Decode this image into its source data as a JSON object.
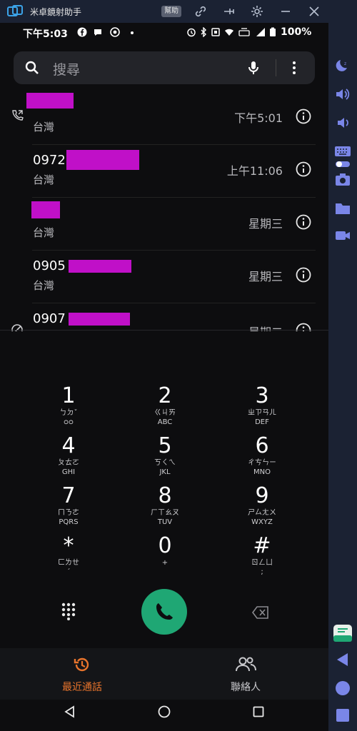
{
  "window": {
    "title": "米卓鏡射助手",
    "help_label": "幫助",
    "controls": [
      "link-icon",
      "pin-icon",
      "gear-icon",
      "minimize-icon",
      "close-icon"
    ]
  },
  "statusbar": {
    "time": "下午5:03",
    "battery": "100%",
    "icons": [
      "facebook-icon",
      "chat-icon",
      "chrome-icon",
      "alarm-icon",
      "bluetooth-icon",
      "nfc-icon",
      "wifi-icon",
      "volte-icon",
      "signal-icon",
      "battery-icon"
    ]
  },
  "search": {
    "placeholder": "搜尋"
  },
  "calls": [
    {
      "number": "",
      "location": "台灣",
      "time": "下午5:01",
      "lead_icon": "outgoing-call-icon"
    },
    {
      "number": "0972",
      "location": "台灣",
      "time": "上午11:06",
      "lead_icon": ""
    },
    {
      "number": "",
      "location": "台灣",
      "time": "星期三",
      "lead_icon": ""
    },
    {
      "number": "0905",
      "location": "台灣",
      "time": "星期三",
      "lead_icon": ""
    },
    {
      "number": "0907",
      "location": "台灣",
      "time": "星期二",
      "lead_icon": "blocked-icon"
    }
  ],
  "dialpad": {
    "keys": [
      {
        "digit": "1",
        "zhuyin": "ㄅㄉˇ",
        "letters": "ᴑᴑ"
      },
      {
        "digit": "2",
        "zhuyin": "ㄍㄐㄞ",
        "letters": "ABC"
      },
      {
        "digit": "3",
        "zhuyin": "ㄓㄗㄢㄦ",
        "letters": "DEF"
      },
      {
        "digit": "4",
        "zhuyin": "ㄆㄊㄛ",
        "letters": "GHI"
      },
      {
        "digit": "5",
        "zhuyin": "ㄎㄑㄟ",
        "letters": "JKL"
      },
      {
        "digit": "6",
        "zhuyin": "ㄔㄘㄣㄧ",
        "letters": "MNO"
      },
      {
        "digit": "7",
        "zhuyin": "ㄇㄋㄜ",
        "letters": "PQRS"
      },
      {
        "digit": "8",
        "zhuyin": "ㄏㄒㄠㄡ",
        "letters": "TUV"
      },
      {
        "digit": "9",
        "zhuyin": "ㄕㄙㄤㄨ",
        "letters": "WXYZ"
      },
      {
        "digit": "*",
        "zhuyin": "ㄈㄌㄝ",
        "letters": "ˊ"
      },
      {
        "digit": "0",
        "zhuyin": "",
        "letters": "+"
      },
      {
        "digit": "#",
        "zhuyin": "ㄖㄥㄩ",
        "letters": ";"
      }
    ]
  },
  "bottom_nav": {
    "recents_label": "最近通話",
    "contacts_label": "聯絡人",
    "active_color": "#e8742c"
  },
  "accent": {
    "call_green": "#1fa774",
    "redaction": "#c010c8"
  },
  "sidebar_tools": [
    "snooze-icon",
    "volume-up-icon",
    "volume-down-icon",
    "keyboard-icon",
    "toggle-icon",
    "camera-icon",
    "folder-icon",
    "record-icon",
    "translate-icon",
    "back-triangle-icon",
    "home-circle-icon",
    "recent-square-icon"
  ]
}
